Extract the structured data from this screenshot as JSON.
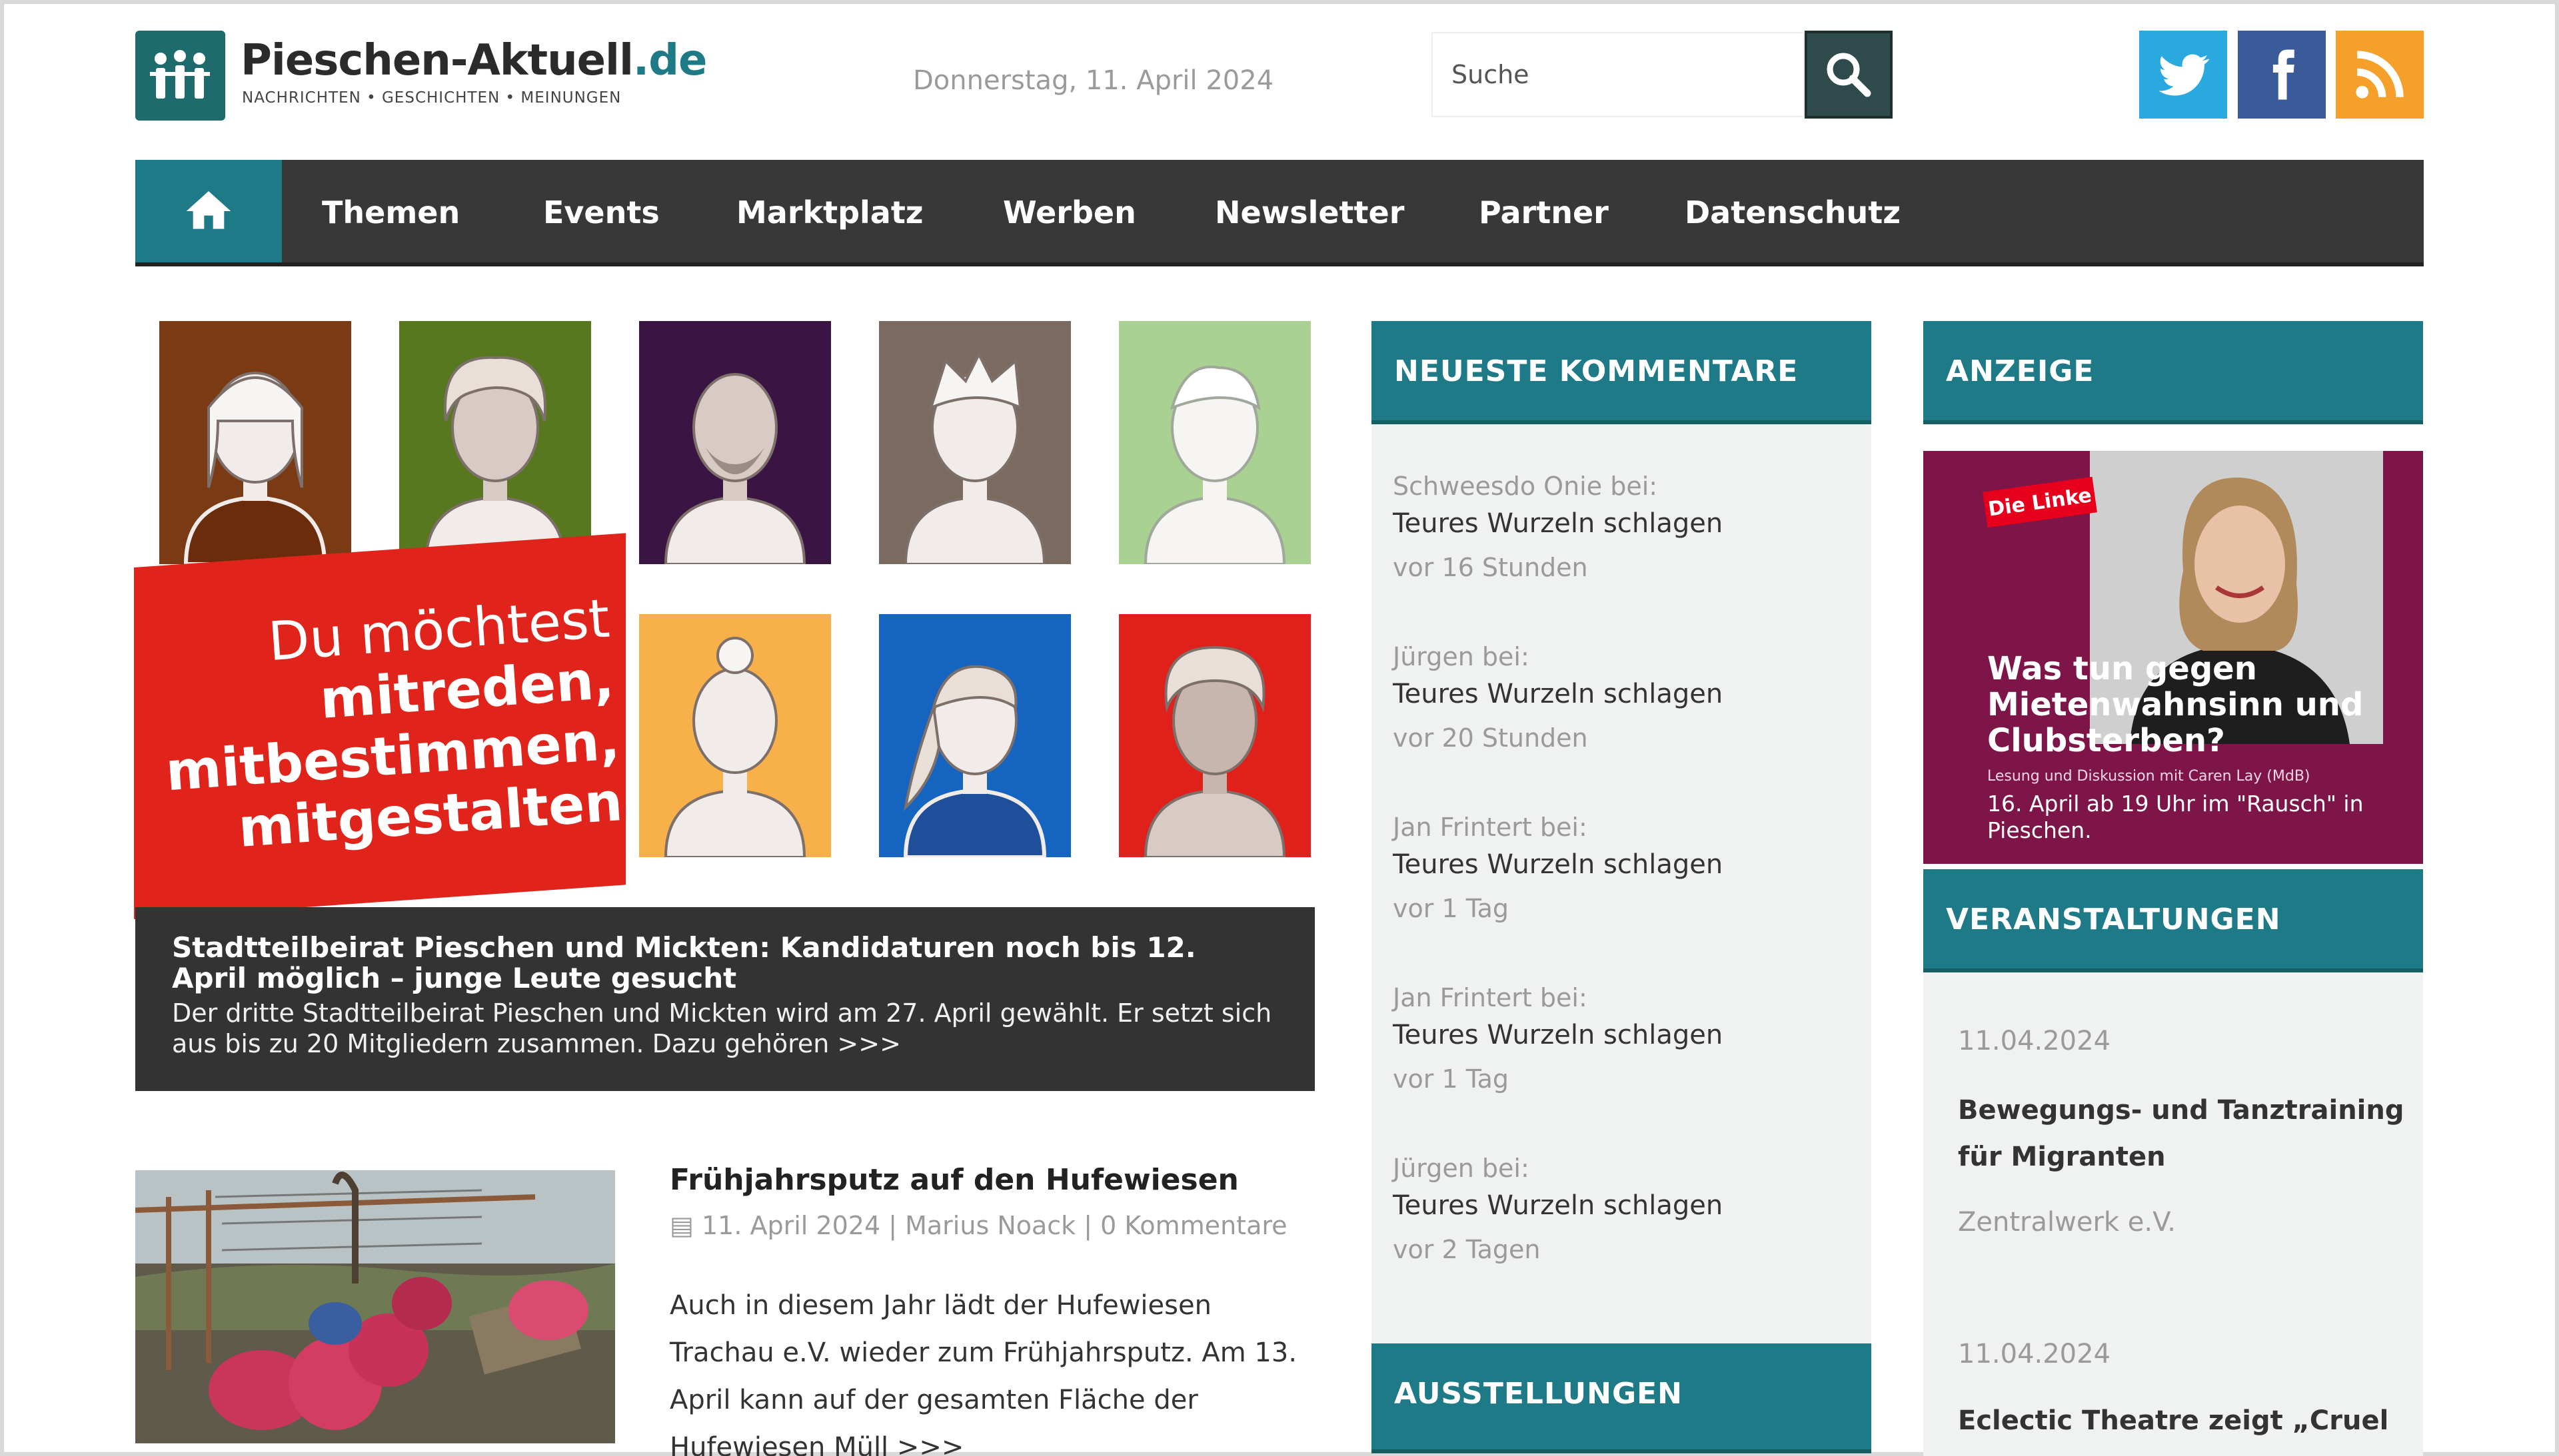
{
  "header": {
    "logo_title": "Pieschen-Aktuell",
    "logo_tld": ".de",
    "logo_subtitle": "NACHRICHTEN • GESCHICHTEN • MEINUNGEN",
    "date": "Donnerstag, 11. April 2024",
    "search_placeholder": "Suche"
  },
  "social": [
    {
      "name": "twitter-icon",
      "color": "#2aa8e0"
    },
    {
      "name": "facebook-icon",
      "color": "#3b5a9a"
    },
    {
      "name": "rss-icon",
      "color": "#f5a02a"
    }
  ],
  "nav": {
    "items": [
      "Themen",
      "Events",
      "Marktplatz",
      "Werben",
      "Newsletter",
      "Partner",
      "Datenschutz"
    ]
  },
  "hero": {
    "line1": "Du möchtest",
    "line2": "mitreden,",
    "line3": "mitbestimmen,",
    "line4": "mitgestalten",
    "caption_title": "Stadtteilbeirat Pieschen und Mickten: Kandidaturen noch bis 12. April möglich – junge Leute gesucht",
    "caption_text": "Der dritte Stadtteilbeirat Pieschen und Mickten wird am 27. April gewählt. Er setzt sich aus bis zu 20 Mitgliedern zusammen. Dazu gehören >>>"
  },
  "article": {
    "title": "Frühjahrsputz auf den Hufewiesen",
    "meta": "11. April 2024 | Marius Noack | 0 Kommentare",
    "text": "Auch in diesem Jahr lädt der Hufewiesen Trachau e.V. wieder zum Frühjahrsputz. Am 13. April kann auf der gesamten Fläche der Hufewiesen Müll >>>"
  },
  "comments": {
    "heading": "NEUESTE KOMMENTARE",
    "items": [
      {
        "author": "Schweesdo Onie bei:",
        "title": "Teures Wurzeln schlagen",
        "time": "vor 16 Stunden"
      },
      {
        "author": "Jürgen bei:",
        "title": "Teures Wurzeln schlagen",
        "time": "vor 20 Stunden"
      },
      {
        "author": "Jan Frintert bei:",
        "title": "Teures Wurzeln schlagen",
        "time": "vor 1 Tag"
      },
      {
        "author": "Jan Frintert bei:",
        "title": "Teures Wurzeln schlagen",
        "time": "vor 1 Tag"
      },
      {
        "author": "Jürgen bei:",
        "title": "Teures Wurzeln schlagen",
        "time": "vor 2 Tagen"
      }
    ]
  },
  "exhibitions": {
    "heading": "AUSSTELLUNGEN"
  },
  "ad": {
    "heading": "ANZEIGE",
    "logo_text": "Die Linke",
    "headline": "Was tun gegen Mietenwahnsinn und Clubsterben?",
    "small": "Lesung und Diskussion mit Caren Lay (MdB)",
    "info": "16. April ab 19 Uhr im \"Rausch\" in Pieschen."
  },
  "events": {
    "heading": "VERANSTALTUNGEN",
    "items": [
      {
        "date": "11.04.2024",
        "title": "Bewegungs- und Tanztraining für Migranten",
        "org": "Zentralwerk e.V."
      },
      {
        "date": "11.04.2024",
        "title": "Eclectic Theatre zeigt „Cruel",
        "org": ""
      }
    ]
  },
  "colors": {
    "teal": "#1d7a86",
    "nav_dark": "#383838",
    "hero_red": "#e0241b",
    "ad_purple": "#7d1548"
  }
}
